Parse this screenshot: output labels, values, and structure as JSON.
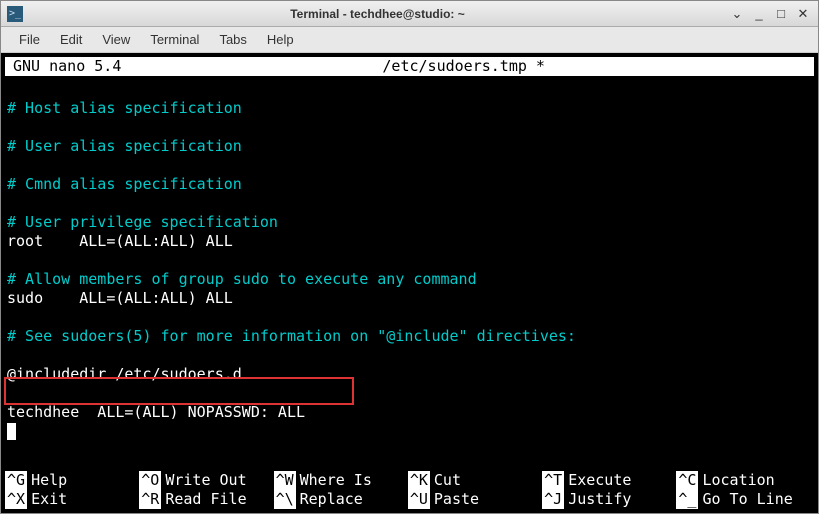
{
  "titlebar": {
    "icon_glyph": ">_",
    "title": "Terminal - techdhee@studio: ~",
    "btn_down": "⌄",
    "btn_min": "_",
    "btn_max": "□",
    "btn_close": "✕"
  },
  "menubar": {
    "file": "File",
    "edit": "Edit",
    "view": "View",
    "terminal": "Terminal",
    "tabs": "Tabs",
    "help": "Help"
  },
  "nano": {
    "version": "  GNU nano 5.4",
    "filename": "/etc/sudoers.tmp *"
  },
  "content": {
    "l1": "# Host alias specification",
    "l2": "# User alias specification",
    "l3": "# Cmnd alias specification",
    "l4": "# User privilege specification",
    "l5": "root    ALL=(ALL:ALL) ALL",
    "l6": "# Allow members of group sudo to execute any command",
    "l7": "sudo    ALL=(ALL:ALL) ALL",
    "l8": "# See sudoers(5) for more information on \"@include\" directives:",
    "l9": "@includedir /etc/sudoers.d",
    "l10": "techdhee  ALL=(ALL) NOPASSWD: ALL"
  },
  "shortcuts": {
    "r1": [
      {
        "key": "^G",
        "label": "Help"
      },
      {
        "key": "^O",
        "label": "Write Out"
      },
      {
        "key": "^W",
        "label": "Where Is"
      },
      {
        "key": "^K",
        "label": "Cut"
      },
      {
        "key": "^T",
        "label": "Execute"
      },
      {
        "key": "^C",
        "label": "Location"
      }
    ],
    "r2": [
      {
        "key": "^X",
        "label": "Exit"
      },
      {
        "key": "^R",
        "label": "Read File"
      },
      {
        "key": "^\\",
        "label": "Replace"
      },
      {
        "key": "^U",
        "label": "Paste"
      },
      {
        "key": "^J",
        "label": "Justify"
      },
      {
        "key": "^_",
        "label": "Go To Line"
      }
    ]
  }
}
